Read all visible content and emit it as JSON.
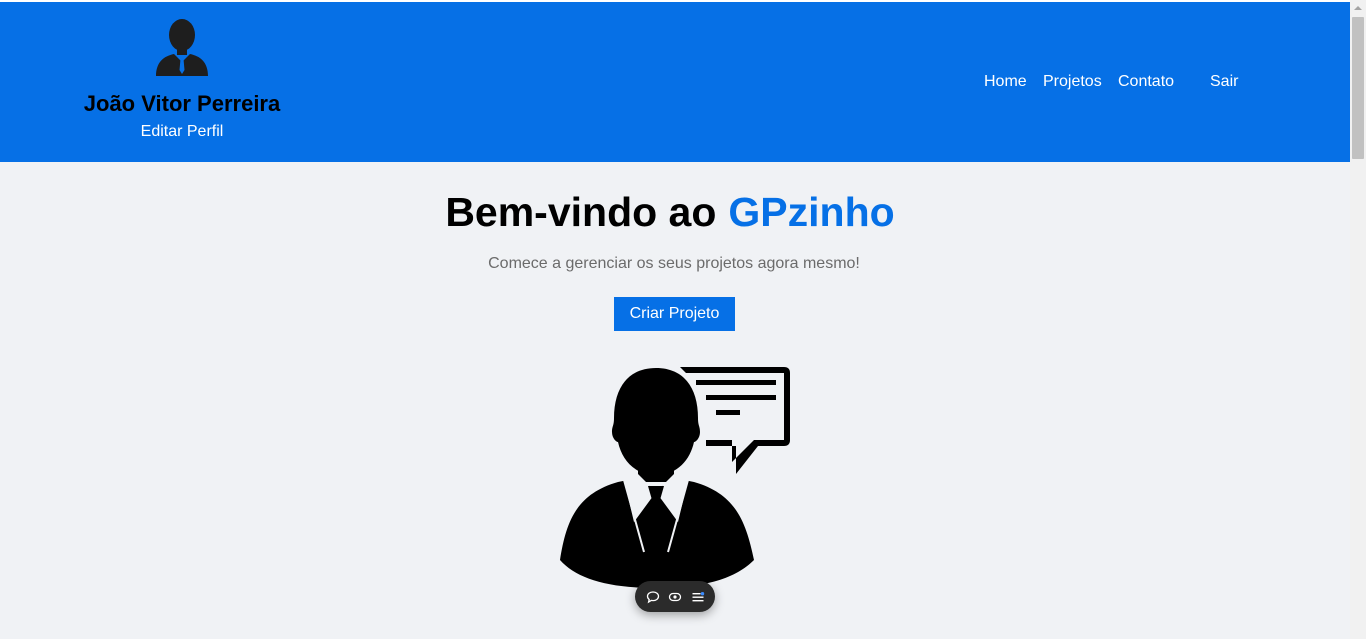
{
  "profile": {
    "avatar_icon": "user-suit-icon",
    "name": "João Vitor Perreira",
    "edit_label": "Editar Perfil"
  },
  "nav": {
    "items": [
      {
        "label": "Home"
      },
      {
        "label": "Projetos"
      },
      {
        "label": "Contato"
      }
    ],
    "logout_label": "Sair"
  },
  "hero": {
    "title_prefix": "Bem-vindo ao",
    "title_brand": "GPzinho",
    "subtitle": "Comece a gerenciar os seus projetos agora mesmo!",
    "cta_label": "Criar Projeto",
    "illustration_icon": "businessman-chat-icon"
  },
  "floating_toolbar": {
    "icons": [
      "comment-icon",
      "eye-icon",
      "list-icon"
    ]
  },
  "colors": {
    "brand_blue": "#0670e6",
    "background": "#f0f2f5",
    "header_text": "#ffffff",
    "subtitle_gray": "#6b6b6b"
  }
}
